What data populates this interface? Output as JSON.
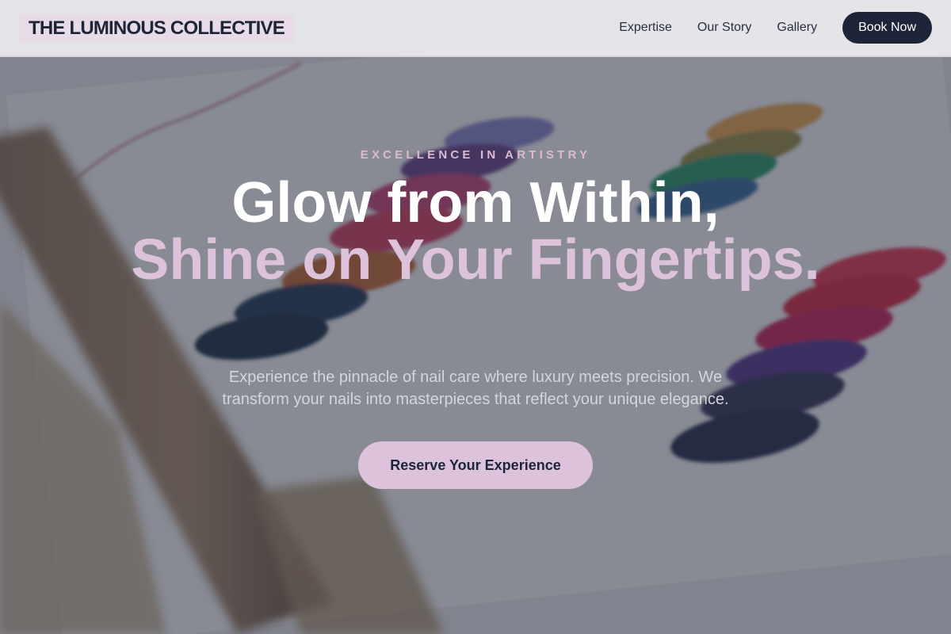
{
  "header": {
    "brand": "THE LUMINOUS COLLECTIVE",
    "nav": [
      "Expertise",
      "Our Story",
      "Gallery"
    ],
    "cta_label": "Book Now"
  },
  "hero": {
    "eyebrow": "EXCELLENCE IN ARTISTRY",
    "headline_line1": "Glow from Within,",
    "headline_line2": "Shine on Your Fingertips.",
    "subtext": "Experience the pinnacle of nail care where luxury meets precision. We transform your nails into masterpieces that reflect your unique elegance.",
    "cta_label": "Reserve Your Experience",
    "background_image": "nail-polish-swatch-chart"
  },
  "colors": {
    "navy": "#1e2538",
    "accent_pink": "#dcc2da",
    "eyebrow_pink": "#dcb9d2",
    "header_bg": "#ececf0"
  }
}
